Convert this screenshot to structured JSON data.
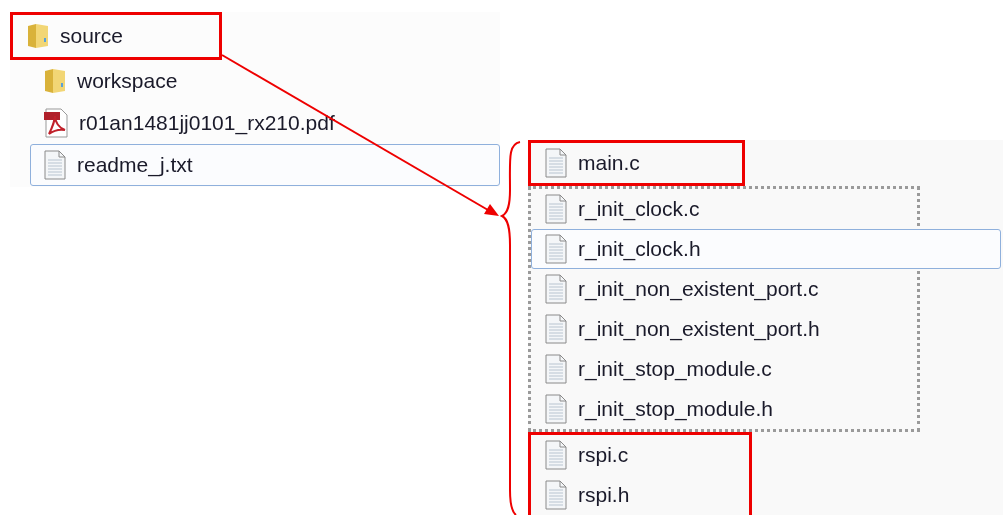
{
  "folder_listing": {
    "groups": [
      {
        "kind": "highlight",
        "items": [
          {
            "kind": "folder",
            "name": "source",
            "selected": false
          }
        ]
      },
      {
        "kind": "plain",
        "items": [
          {
            "kind": "folder",
            "name": "workspace",
            "selected": false
          },
          {
            "kind": "pdf",
            "name": "r01an1481jj0101_rx210.pdf",
            "selected": false
          },
          {
            "kind": "text",
            "name": "readme_j.txt",
            "selected": true
          }
        ]
      }
    ]
  },
  "source_contents": {
    "groups": [
      {
        "kind": "highlight",
        "items": [
          {
            "kind": "text",
            "name": "main.c",
            "selected": false
          }
        ]
      },
      {
        "kind": "dotted",
        "items": [
          {
            "kind": "text",
            "name": "r_init_clock.c",
            "selected": false
          },
          {
            "kind": "text",
            "name": "r_init_clock.h",
            "selected": true
          },
          {
            "kind": "text",
            "name": "r_init_non_existent_port.c",
            "selected": false
          },
          {
            "kind": "text",
            "name": "r_init_non_existent_port.h",
            "selected": false
          },
          {
            "kind": "text",
            "name": "r_init_stop_module.c",
            "selected": false
          },
          {
            "kind": "text",
            "name": "r_init_stop_module.h",
            "selected": false
          }
        ]
      },
      {
        "kind": "highlight",
        "items": [
          {
            "kind": "text",
            "name": "rspi.c",
            "selected": false
          },
          {
            "kind": "text",
            "name": "rspi.h",
            "selected": false
          }
        ]
      }
    ]
  }
}
